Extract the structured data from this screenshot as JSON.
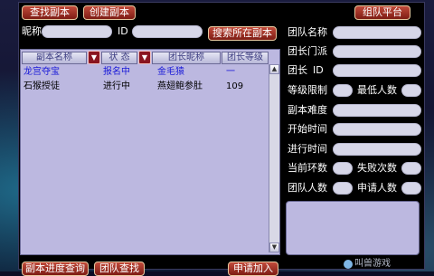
{
  "header": {
    "tab_search": "查找副本",
    "tab_create": "创建副本",
    "team_platform": "组队平台"
  },
  "search": {
    "nick_label": "昵称",
    "nick_value": "",
    "id_label": "ID",
    "id_value": "",
    "search_location_button": "搜索所在副本"
  },
  "table": {
    "columns": [
      "副本名称",
      "状 态",
      "团长昵称",
      "团长等级"
    ],
    "rows": [
      {
        "name": "龙宫夺宝",
        "status": "报名中",
        "leader": "金毛猿",
        "level": "一",
        "selected": true
      },
      {
        "name": "石猴授徒",
        "status": "进行中",
        "leader": "燕翅鲍参肚",
        "level": "109",
        "selected": false
      }
    ]
  },
  "details": {
    "team_name": "团队名称",
    "leader_sect": "团长门派",
    "leader_label": "团长",
    "leader_id": "ID",
    "level_limit": "等级限制",
    "min_people": "最低人数",
    "difficulty": "副本难度",
    "start_time": "开始时间",
    "elapsed_time": "进行时间",
    "current_round": "当前环数",
    "fail_count": "失败次数",
    "team_size": "团队人数",
    "applicants": "申请人数"
  },
  "footer": {
    "progress_query": "副本进度查询",
    "team_query": "团队查找",
    "apply_join": "申请加入"
  },
  "watermark": "叫兽游戏"
}
